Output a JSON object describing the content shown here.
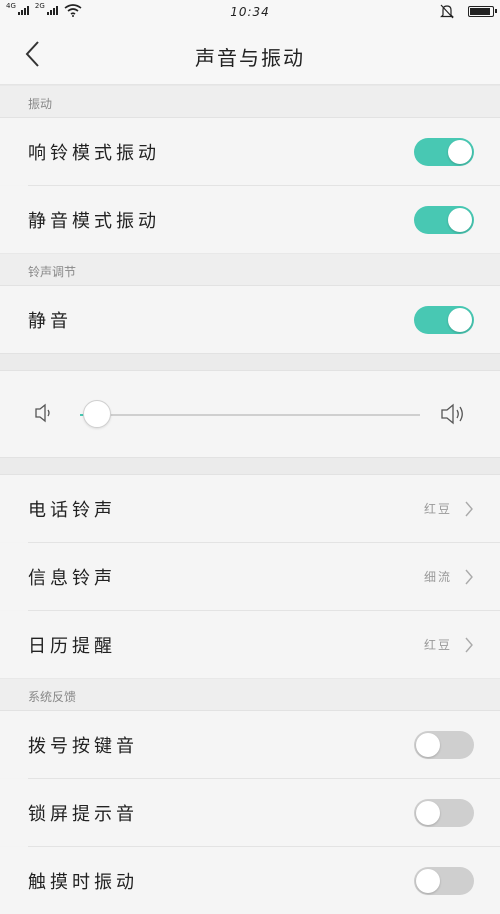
{
  "status_bar": {
    "sim1_label": "4G",
    "sim2_label": "2G",
    "time": "10:34",
    "battery_level": 0.9,
    "icons": [
      "signal-icon",
      "wifi-icon",
      "alarm-off-icon",
      "battery-icon"
    ]
  },
  "header": {
    "title": "声音与振动",
    "back_icon": "chevron-left-icon"
  },
  "sections": {
    "vibration": {
      "title": "振动",
      "items": [
        {
          "label": "响铃模式振动",
          "enabled": true
        },
        {
          "label": "静音模式振动",
          "enabled": true
        }
      ]
    },
    "ringer": {
      "title": "铃声调节",
      "mute_label": "静音",
      "mute_enabled": true,
      "volume_level": 0.05
    },
    "ringtones": {
      "items": [
        {
          "label": "电话铃声",
          "value": "红豆"
        },
        {
          "label": "信息铃声",
          "value": "细流"
        },
        {
          "label": "日历提醒",
          "value": "红豆"
        }
      ]
    },
    "feedback": {
      "title": "系统反馈",
      "items": [
        {
          "label": "拨号按键音",
          "enabled": false
        },
        {
          "label": "锁屏提示音",
          "enabled": false
        },
        {
          "label": "触摸时振动",
          "enabled": false
        }
      ]
    }
  },
  "colors": {
    "accent": "#48c8b3",
    "toggle_off": "#cfcfcf",
    "background": "#f4f4f4"
  }
}
